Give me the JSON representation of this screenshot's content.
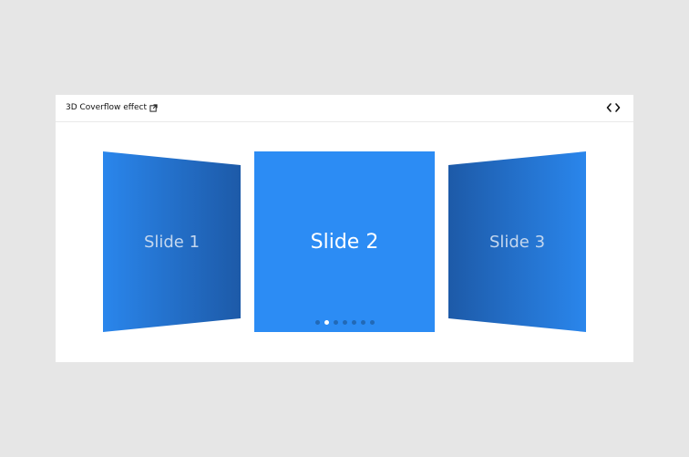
{
  "header": {
    "title": "3D Coverflow effect",
    "external_link_icon": "external-link-icon",
    "code_toggle_icon": "code-icon"
  },
  "slides": [
    {
      "label": "Slide 1",
      "position": "left"
    },
    {
      "label": "Slide 2",
      "position": "center"
    },
    {
      "label": "Slide 3",
      "position": "right"
    }
  ],
  "pagination": {
    "count": 7,
    "active_index": 1
  },
  "colors": {
    "background": "#e6e6e6",
    "card": "#ffffff",
    "slide_blue": "#2c8cf4",
    "slide_shade": "#1f5fae"
  }
}
